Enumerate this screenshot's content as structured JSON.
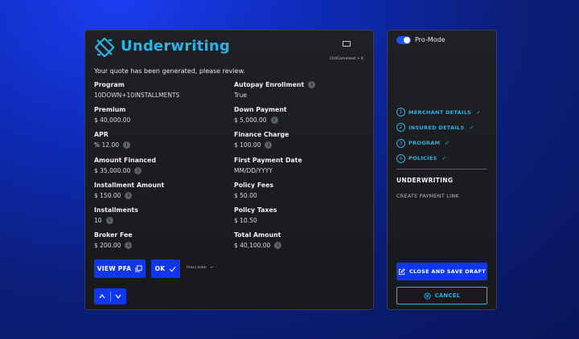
{
  "main": {
    "title": "Underwriting",
    "shortcut": "Ctrl/Command + K",
    "intro": "Your quote has been generated, please review.",
    "fields_left": [
      {
        "label": "Program",
        "value": "10DOWN+10INSTALLMENTS",
        "info_label": false,
        "info_value": false
      },
      {
        "label": "Premium",
        "value": "$ 40,000.00",
        "info_label": false,
        "info_value": false
      },
      {
        "label": "APR",
        "value": "% 12.00",
        "info_label": false,
        "info_value": true
      },
      {
        "label": "Amount Financed",
        "value": "$ 35,000.00",
        "info_label": false,
        "info_value": true
      },
      {
        "label": "Installment Amount",
        "value": "$ 150.00",
        "info_label": false,
        "info_value": true
      },
      {
        "label": "Installments",
        "value": "10",
        "info_label": false,
        "info_value": true
      },
      {
        "label": "Broker Fee",
        "value": "$ 200.00",
        "info_label": false,
        "info_value": true
      }
    ],
    "fields_right": [
      {
        "label": "Autopay Enrollment",
        "value": "True",
        "info_label": true,
        "info_value": false
      },
      {
        "label": "Down Payment",
        "value": "$ 5,000.00",
        "info_label": false,
        "info_value": true
      },
      {
        "label": "Finance Charge",
        "value": "$ 100.00",
        "info_label": false,
        "info_value": true
      },
      {
        "label": "First Payment Date",
        "value": "MM/DD/YYYY",
        "info_label": false,
        "info_value": false
      },
      {
        "label": "Policy Fees",
        "value": "$ 50.00",
        "info_label": false,
        "info_value": false
      },
      {
        "label": "Policy Taxes",
        "value": "$ 10.50",
        "info_label": false,
        "info_value": false
      },
      {
        "label": "Total Amount",
        "value": "$ 40,100.00",
        "info_label": false,
        "info_value": true
      }
    ],
    "view_pfa_label": "VIEW PFA",
    "ok_label": "OK",
    "press_enter": "Press enter"
  },
  "side": {
    "pro_mode_label": "Pro-Mode",
    "pro_mode_on": true,
    "steps": [
      {
        "num": "1",
        "label": "MERCHANT DETAILS"
      },
      {
        "num": "2",
        "label": "INSURED DETAILS"
      },
      {
        "num": "3",
        "label": "PROGRAM"
      },
      {
        "num": "4",
        "label": "POLICIES"
      }
    ],
    "current_step": "UNDERWRITING",
    "next_step": "CREATE PAYMENT LINK",
    "close_save_label": "CLOSE AND SAVE DRAFT",
    "cancel_label": "CANCEL"
  },
  "colors": {
    "accent": "#2ab3e6",
    "button": "#1136f0",
    "panel": "#1c1d21"
  }
}
